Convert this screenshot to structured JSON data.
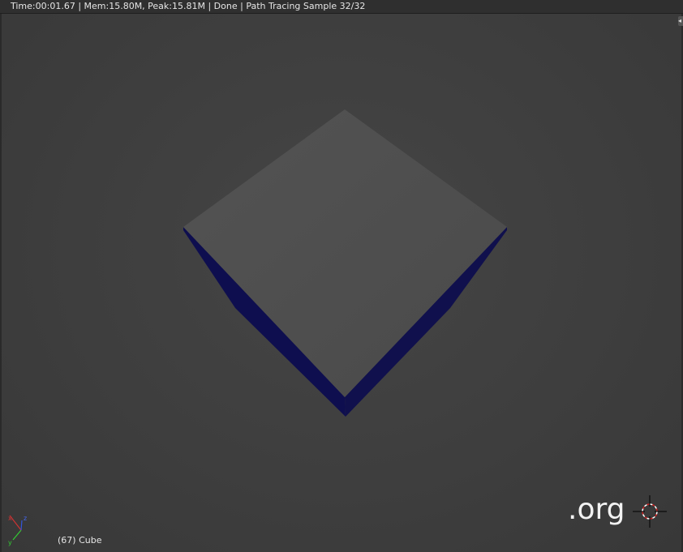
{
  "header": {
    "render_status": "Time:00:01.67 | Mem:15.80M, Peak:15.81M | Done | Path Tracing Sample 32/32"
  },
  "viewport": {
    "object_info": "(67) Cube",
    "watermark": ".org",
    "axis_labels": {
      "x": "x",
      "y": "y",
      "z": "z"
    }
  },
  "colors": {
    "background": "#3d3d3d",
    "cube_top": "#505050",
    "cube_side": "#0f0f4d",
    "axis_x": "#cc3333",
    "axis_y": "#33cc33",
    "axis_z": "#3355dd"
  },
  "icons": {
    "axis_gizmo": "axis-gizmo-icon",
    "cursor": "3d-cursor-icon",
    "corner": "area-split-icon"
  }
}
